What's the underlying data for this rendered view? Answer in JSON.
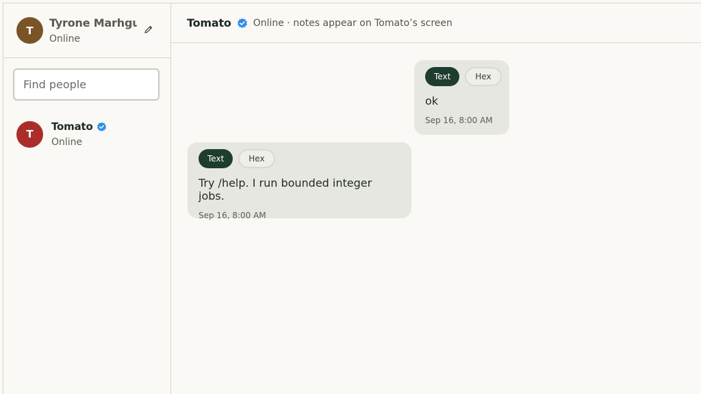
{
  "me": {
    "initial": "T",
    "name": "Tyrone Marhguy",
    "status": "Online",
    "edit_icon": "pencil-icon"
  },
  "search": {
    "placeholder": "Find people",
    "value": ""
  },
  "contacts": [
    {
      "initial": "T",
      "name": "Tomato",
      "status": "Online",
      "verified": true
    }
  ],
  "chat": {
    "title": "Tomato",
    "subtitle": "Online · notes appear on Tomato’s screen",
    "messages": [
      {
        "direction": "outgoing",
        "text_tab": "Text",
        "hex_tab": "Hex",
        "body": "ok",
        "time": "Sep 16, 8:00 AM"
      },
      {
        "direction": "incoming",
        "text_tab": "Text",
        "hex_tab": "Hex",
        "body": "Try /help. I run bounded integer jobs.",
        "time": "Sep 16, 8:00 AM"
      }
    ]
  },
  "colors": {
    "accent": "#1f3d2e",
    "verified": "#2f8ee8",
    "me_avatar": "#7a5427",
    "tomato_avatar": "#ab2d2a",
    "bubble": "#e7e7e2",
    "background": "#faf9f5"
  }
}
